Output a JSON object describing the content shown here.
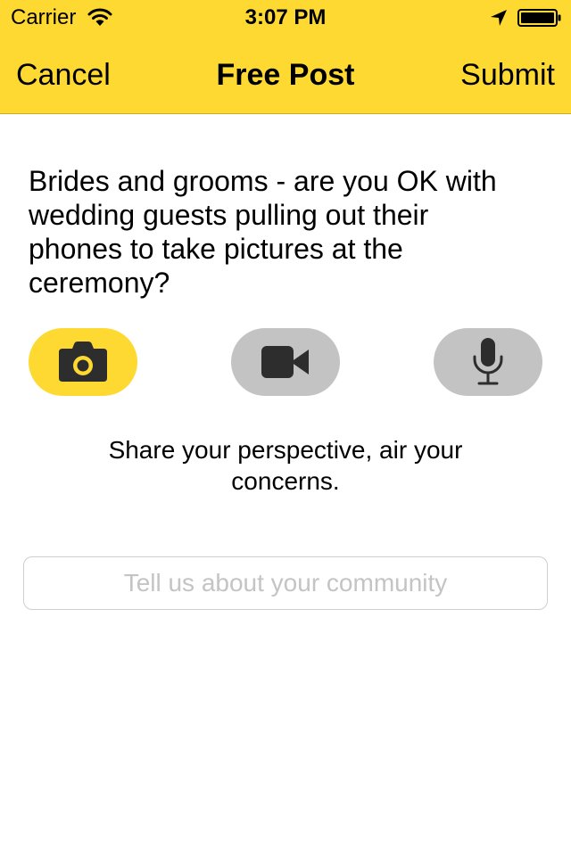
{
  "status_bar": {
    "carrier": "Carrier",
    "time": "3:07 PM",
    "icons": [
      "wifi-icon",
      "location-arrow-icon",
      "battery-icon"
    ]
  },
  "nav": {
    "left_label": "Cancel",
    "title": "Free Post",
    "right_label": "Submit"
  },
  "question": "Brides and grooms - are you OK with wedding guests pulling out their phones to take pictures at the ceremony?",
  "media_buttons": [
    {
      "icon": "camera-icon",
      "state": "selected"
    },
    {
      "icon": "video-camera-icon",
      "state": "unselected"
    },
    {
      "icon": "microphone-icon",
      "state": "unselected"
    }
  ],
  "prompt": "Share your perspective, air your concerns.",
  "community_input": {
    "value": "",
    "placeholder": "Tell us about your community"
  },
  "colors": {
    "accent": "#fed931",
    "button_inactive": "#c3c3c3",
    "icon_dark": "#2d2d2d"
  }
}
